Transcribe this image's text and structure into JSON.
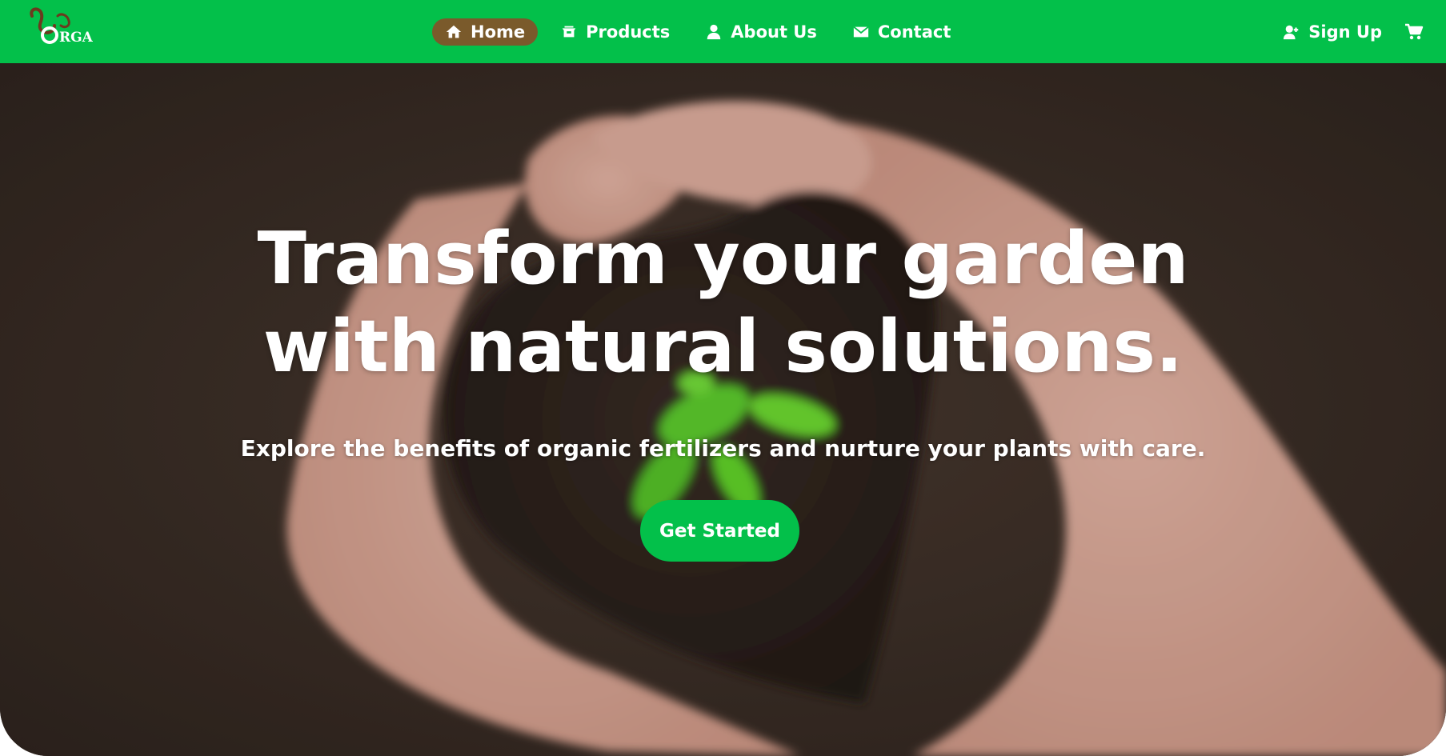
{
  "brand": {
    "logo_text": "ORGA",
    "accent": "#03c04a",
    "active_pill": "#7a5a2b"
  },
  "nav": {
    "items": [
      {
        "label": "Home",
        "icon": "home-icon",
        "active": true
      },
      {
        "label": "Products",
        "icon": "products-icon",
        "active": false
      },
      {
        "label": "About Us",
        "icon": "user-icon",
        "active": false
      },
      {
        "label": "Contact",
        "icon": "envelope-icon",
        "active": false
      }
    ],
    "signup_label": "Sign Up",
    "signup_icon": "user-plus-icon",
    "cart_icon": "cart-icon"
  },
  "hero": {
    "title_line1": "Transform your garden",
    "title_line2": "with natural solutions.",
    "subtitle": "Explore the benefits of organic fertilizers and nurture your plants with care.",
    "cta_label": "Get Started"
  }
}
